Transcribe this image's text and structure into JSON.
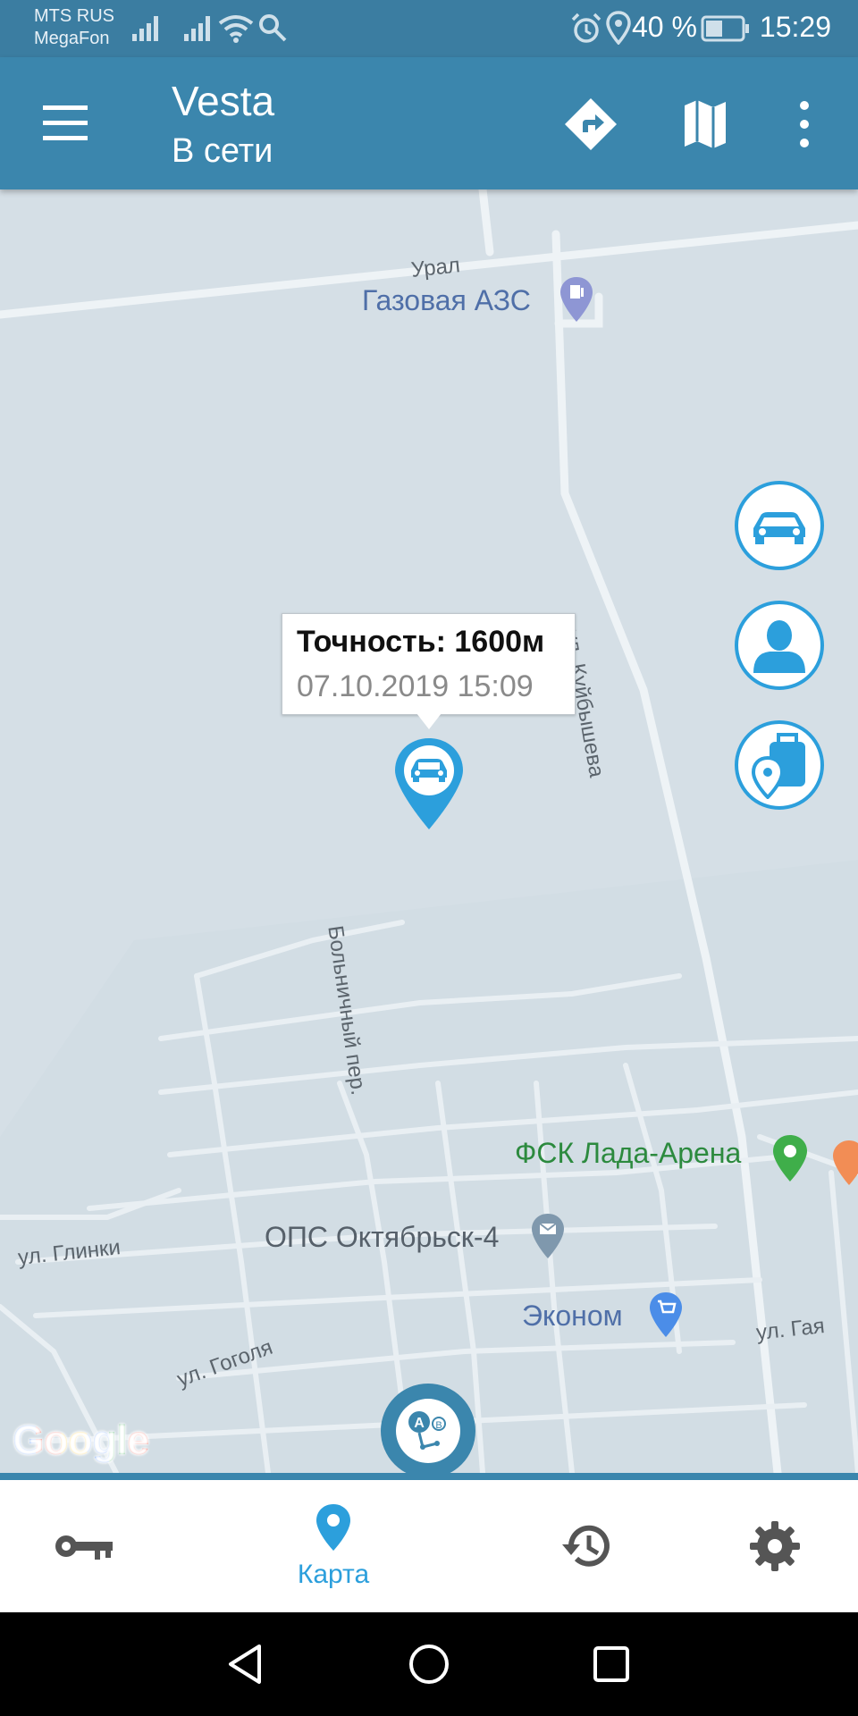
{
  "status_bar": {
    "carrier_1": "MTS RUS",
    "carrier_2": "MegaFon",
    "battery": "40 %",
    "time": "15:29",
    "icons": [
      "signal-icon",
      "signal-icon",
      "wifi-icon",
      "search-icon",
      "alarm-icon",
      "location-icon",
      "battery-icon"
    ]
  },
  "app_bar": {
    "title": "Vesta",
    "subtitle": "В сети",
    "icons": [
      "menu-icon",
      "directions-icon",
      "map-icon",
      "more-icon"
    ]
  },
  "map": {
    "labels": {
      "ural": "Урал",
      "gas_station": "Газовая АЗС",
      "kuybysheva": "ул. Куйбышева",
      "bolnichny": "Больничный пер.",
      "fsk": "ФСК Лада-Арена",
      "ops": "ОПС Октябрьск-4",
      "ekonom": "Эконом",
      "glinki": "ул. Глинки",
      "gogolya": "ул. Гоголя",
      "gaya": "ул. Гая",
      "google": "Google"
    },
    "callout": {
      "accuracy": "Точность: 1600м",
      "datetime": "07.10.2019 15:09"
    }
  },
  "bottom_nav": {
    "active_label": "Карта",
    "items": [
      "key-icon",
      "map-pin-icon",
      "history-icon",
      "settings-icon"
    ]
  },
  "colors": {
    "status_bar": "#3b7da1",
    "app_bar": "#3b86ad",
    "accent": "#2c9fdc",
    "map_bg": "#d5dfe6"
  }
}
